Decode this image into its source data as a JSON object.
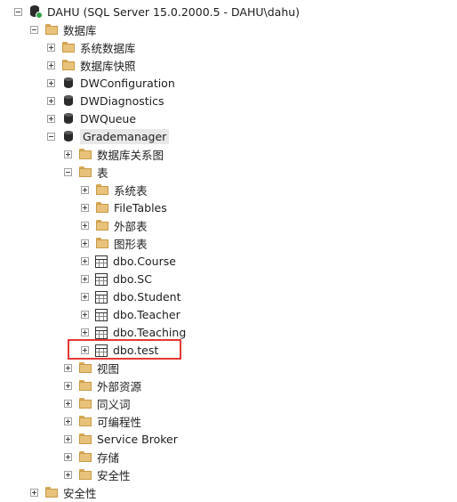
{
  "server": {
    "label": "DAHU (SQL Server 15.0.2000.5 - DAHU\\dahu)"
  },
  "nodes": {
    "databases": "数据库",
    "system_databases": "系统数据库",
    "database_snapshots": "数据库快照",
    "dwconfiguration": "DWConfiguration",
    "dwdiagnostics": "DWDiagnostics",
    "dwqueue": "DWQueue",
    "grademanager": "Grademanager",
    "db_diagrams": "数据库关系图",
    "tables": "表",
    "system_tables": "系统表",
    "filetables": "FileTables",
    "external_tables": "外部表",
    "graph_tables": "图形表",
    "dbo_course": "dbo.Course",
    "dbo_sc": "dbo.SC",
    "dbo_student": "dbo.Student",
    "dbo_teacher": "dbo.Teacher",
    "dbo_teaching": "dbo.Teaching",
    "dbo_test": "dbo.test",
    "views": "视图",
    "external_resources": "外部资源",
    "synonyms": "同义词",
    "programmability": "可编程性",
    "service_broker": "Service Broker",
    "storage": "存储",
    "db_security": "安全性",
    "security": "安全性"
  }
}
